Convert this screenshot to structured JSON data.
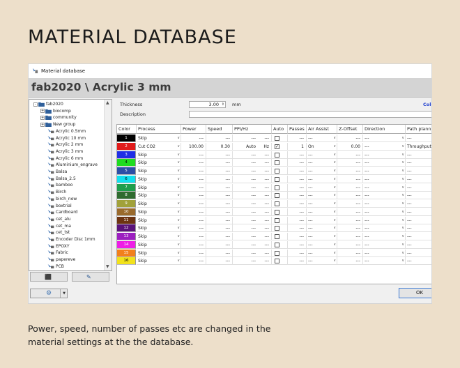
{
  "page_title": "MATERIAL DATABASE",
  "caption": "Power, speed, number of passes etc are changed in the material settings at the the database.",
  "window": {
    "title": "Material database",
    "header_title": "fab2020 \\ Acrylic 3 mm"
  },
  "tree": {
    "items": [
      {
        "label": "fab2020",
        "kind": "folder",
        "indent": 0,
        "expander": "-"
      },
      {
        "label": "biocomp",
        "kind": "folder",
        "indent": 1,
        "expander": "+"
      },
      {
        "label": "community",
        "kind": "folder",
        "indent": 1,
        "expander": "+"
      },
      {
        "label": "New group",
        "kind": "folder",
        "indent": 1,
        "expander": "+"
      },
      {
        "label": "Acrylic 0.5mm",
        "kind": "material",
        "indent": 2
      },
      {
        "label": "Acrylic 10 mm",
        "kind": "material",
        "indent": 2
      },
      {
        "label": "Acrylic 2 mm",
        "kind": "material",
        "indent": 2
      },
      {
        "label": "Acrylic 3 mm",
        "kind": "material",
        "indent": 2
      },
      {
        "label": "Acrylic 6 mm",
        "kind": "material",
        "indent": 2
      },
      {
        "label": "Aluminium_engrave",
        "kind": "material",
        "indent": 2
      },
      {
        "label": "Balsa",
        "kind": "material",
        "indent": 2
      },
      {
        "label": "Balsa_2.5",
        "kind": "material",
        "indent": 2
      },
      {
        "label": "bamboo",
        "kind": "material",
        "indent": 2
      },
      {
        "label": "Birch",
        "kind": "material",
        "indent": 2
      },
      {
        "label": "birch_new",
        "kind": "material",
        "indent": 2
      },
      {
        "label": "boxtrial",
        "kind": "material",
        "indent": 2
      },
      {
        "label": "Cardboard",
        "kind": "material",
        "indent": 2
      },
      {
        "label": "cet_alu",
        "kind": "material",
        "indent": 2
      },
      {
        "label": "cet_ma",
        "kind": "material",
        "indent": 2
      },
      {
        "label": "cet_tst",
        "kind": "material",
        "indent": 2
      },
      {
        "label": "Encoder Disc 1mm",
        "kind": "material",
        "indent": 2
      },
      {
        "label": "EPOXY",
        "kind": "material",
        "indent": 2
      },
      {
        "label": "Fabric",
        "kind": "material",
        "indent": 2
      },
      {
        "label": "papereve",
        "kind": "material",
        "indent": 2
      },
      {
        "label": "PCB",
        "kind": "material",
        "indent": 2
      }
    ]
  },
  "form": {
    "thickness_label": "Thickness",
    "thickness_value": "3.00",
    "thickness_unit": "mm",
    "color_label": "Colo",
    "description_label": "Description"
  },
  "grid": {
    "columns": [
      "Color",
      "Process",
      "Power",
      "Speed",
      "PPI/Hz",
      "Auto",
      "Passes",
      "Air Assist",
      "Z-Offset",
      "Direction",
      "Path planning"
    ],
    "rows": [
      {
        "num": "1",
        "color": "#000000",
        "text_color": "#ffffff",
        "process": "Skip",
        "power": "---",
        "speed": "---",
        "ppi": "---",
        "ppi_unit": "---",
        "auto": false,
        "passes": "---",
        "air": "---",
        "zoff": "---",
        "dir": "---",
        "path": "---"
      },
      {
        "num": "2",
        "color": "#e11b1b",
        "text_color": "#ffffff",
        "process": "Cut CO2",
        "power": "100.00",
        "speed": "0.30",
        "ppi": "Auto",
        "ppi_unit": "Hz",
        "auto": true,
        "passes": "1",
        "air": "On",
        "zoff": "0.00",
        "dir": "---",
        "path": "Throughput"
      },
      {
        "num": "3",
        "color": "#1f2ee6",
        "text_color": "#ffffff",
        "process": "Skip",
        "power": "---",
        "speed": "---",
        "ppi": "---",
        "ppi_unit": "---",
        "auto": false,
        "passes": "---",
        "air": "---",
        "zoff": "---",
        "dir": "---",
        "path": "---"
      },
      {
        "num": "4",
        "color": "#1fdc1f",
        "text_color": "#000000",
        "process": "Skip",
        "power": "---",
        "speed": "---",
        "ppi": "---",
        "ppi_unit": "---",
        "auto": false,
        "passes": "---",
        "air": "---",
        "zoff": "---",
        "dir": "---",
        "path": "---"
      },
      {
        "num": "5",
        "color": "#2d4fa6",
        "text_color": "#ffffff",
        "process": "Skip",
        "power": "---",
        "speed": "---",
        "ppi": "---",
        "ppi_unit": "---",
        "auto": false,
        "passes": "---",
        "air": "---",
        "zoff": "---",
        "dir": "---",
        "path": "---"
      },
      {
        "num": "6",
        "color": "#12e0ee",
        "text_color": "#000000",
        "process": "Skip",
        "power": "---",
        "speed": "---",
        "ppi": "---",
        "ppi_unit": "---",
        "auto": false,
        "passes": "---",
        "air": "---",
        "zoff": "---",
        "dir": "---",
        "path": "---"
      },
      {
        "num": "7",
        "color": "#1d9e4b",
        "text_color": "#ffffff",
        "process": "Skip",
        "power": "---",
        "speed": "---",
        "ppi": "---",
        "ppi_unit": "---",
        "auto": false,
        "passes": "---",
        "air": "---",
        "zoff": "---",
        "dir": "---",
        "path": "---"
      },
      {
        "num": "8",
        "color": "#2f6b2f",
        "text_color": "#ffffff",
        "process": "Skip",
        "power": "---",
        "speed": "---",
        "ppi": "---",
        "ppi_unit": "---",
        "auto": false,
        "passes": "---",
        "air": "---",
        "zoff": "---",
        "dir": "---",
        "path": "---"
      },
      {
        "num": "9",
        "color": "#a1a13a",
        "text_color": "#ffffff",
        "process": "Skip",
        "power": "---",
        "speed": "---",
        "ppi": "---",
        "ppi_unit": "---",
        "auto": false,
        "passes": "---",
        "air": "---",
        "zoff": "---",
        "dir": "---",
        "path": "---"
      },
      {
        "num": "10",
        "color": "#9a6a2c",
        "text_color": "#ffffff",
        "process": "Skip",
        "power": "---",
        "speed": "---",
        "ppi": "---",
        "ppi_unit": "---",
        "auto": false,
        "passes": "---",
        "air": "---",
        "zoff": "---",
        "dir": "---",
        "path": "---"
      },
      {
        "num": "11",
        "color": "#6d3412",
        "text_color": "#ffffff",
        "process": "Skip",
        "power": "---",
        "speed": "---",
        "ppi": "---",
        "ppi_unit": "---",
        "auto": false,
        "passes": "---",
        "air": "---",
        "zoff": "---",
        "dir": "---",
        "path": "---"
      },
      {
        "num": "12",
        "color": "#5a137a",
        "text_color": "#ffffff",
        "process": "Skip",
        "power": "---",
        "speed": "---",
        "ppi": "---",
        "ppi_unit": "---",
        "auto": false,
        "passes": "---",
        "air": "---",
        "zoff": "---",
        "dir": "---",
        "path": "---"
      },
      {
        "num": "13",
        "color": "#9c1fc0",
        "text_color": "#ffffff",
        "process": "Skip",
        "power": "---",
        "speed": "---",
        "ppi": "---",
        "ppi_unit": "---",
        "auto": false,
        "passes": "---",
        "air": "---",
        "zoff": "---",
        "dir": "---",
        "path": "---"
      },
      {
        "num": "14",
        "color": "#ee1ee6",
        "text_color": "#ffffff",
        "process": "Skip",
        "power": "---",
        "speed": "---",
        "ppi": "---",
        "ppi_unit": "---",
        "auto": false,
        "passes": "---",
        "air": "---",
        "zoff": "---",
        "dir": "---",
        "path": "---"
      },
      {
        "num": "15",
        "color": "#f2801c",
        "text_color": "#ffffff",
        "process": "Skip",
        "power": "---",
        "speed": "---",
        "ppi": "---",
        "ppi_unit": "---",
        "auto": false,
        "passes": "---",
        "air": "---",
        "zoff": "---",
        "dir": "---",
        "path": "---"
      },
      {
        "num": "16",
        "color": "#f2e21c",
        "text_color": "#000000",
        "process": "Skip",
        "power": "---",
        "speed": "---",
        "ppi": "---",
        "ppi_unit": "---",
        "auto": false,
        "passes": "---",
        "air": "---",
        "zoff": "---",
        "dir": "---",
        "path": "---"
      }
    ]
  },
  "buttons": {
    "ok_label": "OK"
  },
  "icons": {
    "window": "material-database-icon",
    "folder": "folder-icon",
    "material": "material-icon",
    "gear": "gear-icon"
  }
}
